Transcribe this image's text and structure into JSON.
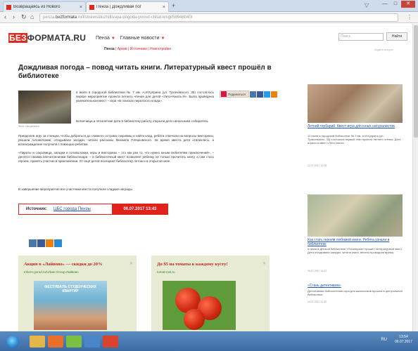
{
  "browser": {
    "tabs": [
      {
        "label": "Возвращаясь из Нового"
      },
      {
        "label": "Пенза | Дождливая пог"
      }
    ],
    "url_prefix": "penza.",
    "url_domain": "bezformata",
    "url_rest": ".ru/listnews/dozhdlivaya-pogoda-povod-chitat-knigi/58948040/",
    "newtab": "+"
  },
  "site": {
    "logo_part1": "БЕЗ",
    "logo_part2": "ФОРМАТА",
    "logo_part3": ".RU",
    "nav": [
      {
        "label": "Пенза"
      },
      {
        "label": "Главные новости"
      }
    ],
    "subnav": [
      "Пенза",
      "Архив",
      "Источники",
      "Новостройки"
    ],
    "search_placeholder": "Поиск",
    "search_button": "Найти",
    "extended_search": "Задать вопрос"
  },
  "article": {
    "headline": "Дождливая погода – повод читать книги. Литературный квест прошёл в библиотеке",
    "photo_caption": "Фото: cbs-penza.ru",
    "p1": "6 июля в городской библиотеке № 7 им. А.И.Куприна (ул. Тухачевского, 35) состоялось первое мероприятие проекта летнего чтения для детей «Лето+Книга=Я». Была проведена увлекательная квест – игра «В поисках пиратского клада».",
    "p2": "Ботинчищи и пятилетние дети в библиотеку работу открыли дети начальника собиратель",
    "p3": "Преодолев игру за станции, чтобы добраться до главного острова сокровищ и найти клад, ребята отвечали на вопросы викторины, решали головоломки, отгадывали загадки, читали рассказы Михаила Пляцковского. За время квеста дети отвлеклись, а вознаграждение получили с помощью ребятам.",
    "p4": "«Пираты и сокровища, загадки и головоломки, игры и викторины – это как раз то, что нужно юным любителям приключений», – делятся своими впечатлениями библиотекари. – в библиотечный квест позволяет ребенку не только прочитать книгу, а сам стать героем, принять участие в приключении. От ещё детей посещают библиотеку летом и в открытой окне.",
    "p5": "В завершение мероприятия все участники квеста получили сладкие награды.",
    "share_label": "Поделиться",
    "source_label": "Источник:",
    "source_name": "ЦБС города Пензы",
    "source_date": "06.07.2017  13:43"
  },
  "ads": [
    {
      "title": "Акция в «Лайвово» — скидки до 20%",
      "url": "Inform-gorod.ru/Urban-Group-Лайвово",
      "image_text": "ФЕСТИВАЛЬ СТУДЕНЧЕСКИХ КВАРТИР",
      "close": "✕"
    },
    {
      "title": "До $5 на томаты к каждому кусту!",
      "url": "tomat-rost.ru",
      "close": "✕"
    }
  ],
  "sidebar": [
    {
      "title": "Летний гербарий. Квест-игра для юных натуралистов",
      "text": "12 июля в городской библиотеке № 7 им. А.И.Куприна (ул. Тухачевского, 35) состоялся первый этап проекта летнего чтения. Дети играли в квест «Лето книги».",
      "date": "12.07.2017 10:05"
    },
    {
      "title": "Как стать героем любимой книги. Ребята узнали в библиотеке",
      "text": "6 июля в детской библиотеке «Почемучка» прошёл литературный квест. Дети отгадывали загадки, читали книги, весело проводили время.",
      "date": "06.07.2017 14:22"
    },
    {
      "title": "«Стань детективом»",
      "text": "Детективная библиотечная игра для школьников прошла в центральной библиотеке.",
      "date": "04.07.2017 11:30"
    }
  ],
  "taskbar": {
    "time": "13:54",
    "date": "06.07.2017",
    "tray_lang": "RU"
  }
}
